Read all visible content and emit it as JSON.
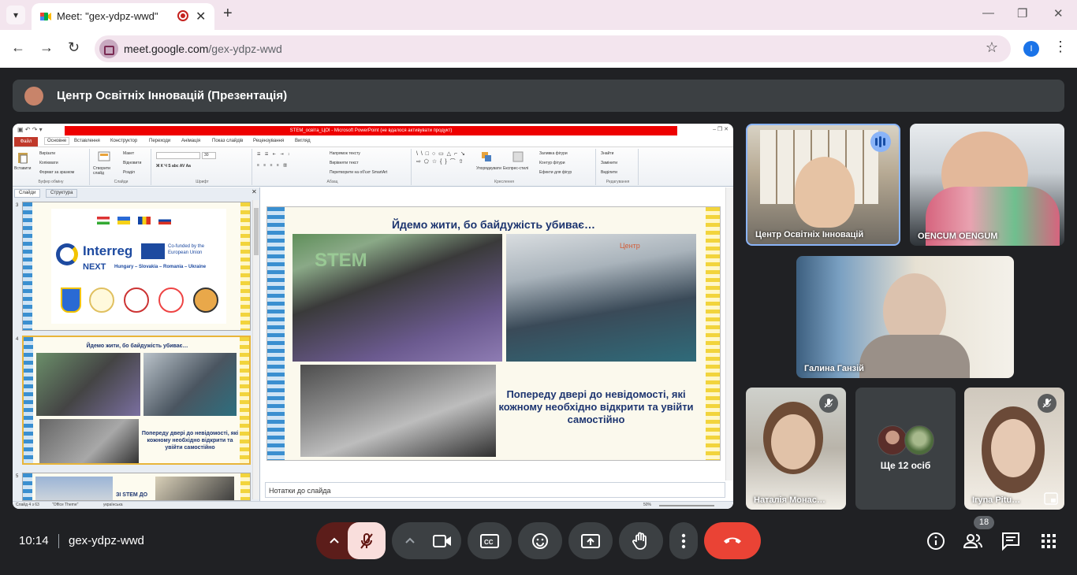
{
  "browser": {
    "tab_title": "Meet: \"gex-ydpz-wwd\"",
    "url_host": "meet.google.com",
    "url_path": "/gex-ydpz-wwd",
    "profile_initial": "I"
  },
  "banner": {
    "title": "Центр Освітніх Інновацій (Презентація)"
  },
  "powerpoint": {
    "window_title": "STEM_освіта_ЦОІ - Microsoft PowerPoint (не вдалося активувати продукт)",
    "file_tab": "Файл",
    "ribbon_tabs": [
      "Основне",
      "Вставлення",
      "Конструктор",
      "Переходи",
      "Анімація",
      "Показ слайдів",
      "Рецензування",
      "Вигляд"
    ],
    "groups": [
      "Буфер обміну",
      "Слайди",
      "Шрифт",
      "Абзац",
      "Креслення",
      "Редагування"
    ],
    "clipboard": {
      "paste": "Вставити",
      "cut": "Вирізати",
      "copy": "Копіювати",
      "format": "Формат за зразком"
    },
    "slides_group": {
      "new": "Створити слайд",
      "layout": "Макет",
      "reset": "Відновити",
      "section": "Розділ"
    },
    "paragraph": {
      "direction": "Напрямок тексту",
      "align": "Вирівняти текст",
      "smartart": "Перетворити на об'єкт SmartArt"
    },
    "drawing": {
      "arrange": "Упорядкувати",
      "styles": "Експрес-стилі",
      "fill": "Заливка фігури",
      "outline": "Контур фігури",
      "effects": "Ефекти для фігур"
    },
    "editing": {
      "find": "Знайти",
      "replace": "Замінити",
      "select": "Виділити"
    },
    "font_size": "30",
    "pane_tabs": [
      "Слайди",
      "Структура"
    ],
    "slide_nums": [
      "3",
      "4",
      "5"
    ],
    "thumb3": {
      "brand": "Interreg",
      "next": "NEXT",
      "countries": "Hungary – Slovakia – Romania – Ukraine",
      "cofund": "Co-funded by the European Union"
    },
    "thumb4": {
      "title": "Йдемо жити, бо байдужість убиває…",
      "quote": "Попереду двері до невідомості, які кожному необхідно відкрити та увійти самостійно"
    },
    "thumb5": {
      "label": "ЗІ STEM ДО"
    },
    "main_slide": {
      "title": "Йдемо жити, бо байдужість убиває…",
      "quote": "Попереду двері до невідомості, які кожному необхідно відкрити та увійти самостійно",
      "banner_text": "Центр"
    },
    "notes": "Нотатки до слайда",
    "status": {
      "slide": "Слайд 4 з 63",
      "theme": "\"Office Theme\"",
      "lang": "українська",
      "zoom": "50%"
    }
  },
  "participants": [
    {
      "name": "Центр Освітніх Інновацій",
      "speaking": true
    },
    {
      "name": "OENCUM OENGUM"
    },
    {
      "name": "Галина Ганзій"
    },
    {
      "name": "Наталія Монас…",
      "muted": true
    },
    {
      "name": "Ще 12 осіб"
    },
    {
      "name": "Iryna Pitu…",
      "muted": true
    }
  ],
  "bottom": {
    "time": "10:14",
    "code": "gex-ydpz-wwd",
    "participant_count": "18"
  },
  "colors": {
    "end_call": "#ea4335",
    "mic_muted": "#f9dedc",
    "slide_title": "#1d3570"
  }
}
